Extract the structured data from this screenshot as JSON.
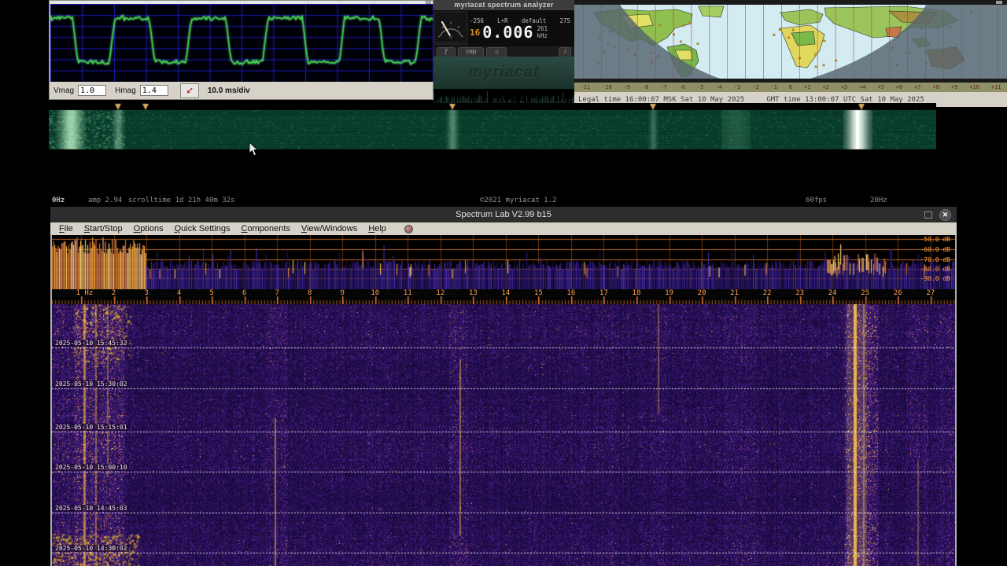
{
  "scope": {
    "vmag_label": "Vmag",
    "vmag_value": "1.0",
    "hmag_label": "Hmag",
    "hmag_value": "1.4",
    "timebase_label": "10.0 ms/div"
  },
  "myriacat": {
    "title": "myriacat spectrum analyzer",
    "readout": {
      "range": "-256",
      "channel": "L+R",
      "preset": "default",
      "top_right": "275",
      "index": "16",
      "frequency": "0.006",
      "sub_value": "261",
      "unit": "kHz"
    },
    "tabs": {
      "tab1": "ƒ",
      "tab2": "cep",
      "tab3": "♫",
      "info": "i"
    },
    "watermark": "myriacat",
    "status_items": [
      "0Hz",
      "amp 2.94",
      "scrolltime 1d 21h 40m 32s",
      "©2021 myriacat 1.2",
      "60fps",
      "20Hz"
    ]
  },
  "map": {
    "legal_time": "Legal time 16:00:07 MSK Sat 10 May 2025",
    "gmt_time": "GMT time 13:00:07 UTC Sat 10 May 2025",
    "timezone_labels": [
      "-11",
      "-10",
      "-9",
      "-8",
      "-7",
      "-6",
      "-5",
      "-4",
      "-3",
      "-2",
      "-1",
      "0",
      "+1",
      "+2",
      "+3",
      "+4",
      "+5",
      "+6",
      "+7",
      "+8",
      "+9",
      "+10",
      "+11"
    ]
  },
  "spectrum_lab": {
    "title": "Spectrum Lab V2.99 b15",
    "menu": [
      "File",
      "Start/Stop",
      "Options",
      "Quick Settings",
      "Components",
      "View/Windows",
      "Help"
    ],
    "close_glyph": "✕",
    "db_labels": [
      "-50.0 dB",
      "-60.0 dB",
      "-70.0 dB",
      "-80.0 dB",
      "-90.0 dB"
    ],
    "freq_labels": [
      "1 Hz",
      "2",
      "3",
      "4",
      "5",
      "6",
      "7",
      "8",
      "9",
      "10",
      "11",
      "12",
      "13",
      "14",
      "15",
      "16",
      "17",
      "18",
      "19",
      "20",
      "21",
      "22",
      "23",
      "24",
      "25",
      "26",
      "27"
    ],
    "timestamps": [
      "2025-05-10 15:45:32",
      "2025-05-10 15:30:02",
      "2025-05-10 15:15:01",
      "2025-05-10 15:00:10",
      "2025-05-10 14:45:03",
      "2025-05-10 14:30:02"
    ]
  },
  "colors": {
    "scope_bg": "#000008",
    "scope_grid": "#1c1cc0",
    "scope_trace": "#3fe052",
    "mc_orange": "#d5921e",
    "sl_orange": "#ff9a38",
    "sl_grid_orange": "#c06522",
    "waterfall_purple": "#34156e",
    "waterfall_yellow": "#ffd860",
    "green_base": "#08392a",
    "titlebar_bg": "#2d2d2d",
    "menubar_bg": "#d6d2c8",
    "map_day": "#d2ecf2",
    "map_night": "#566470",
    "map_grid_red": "#b04040"
  }
}
